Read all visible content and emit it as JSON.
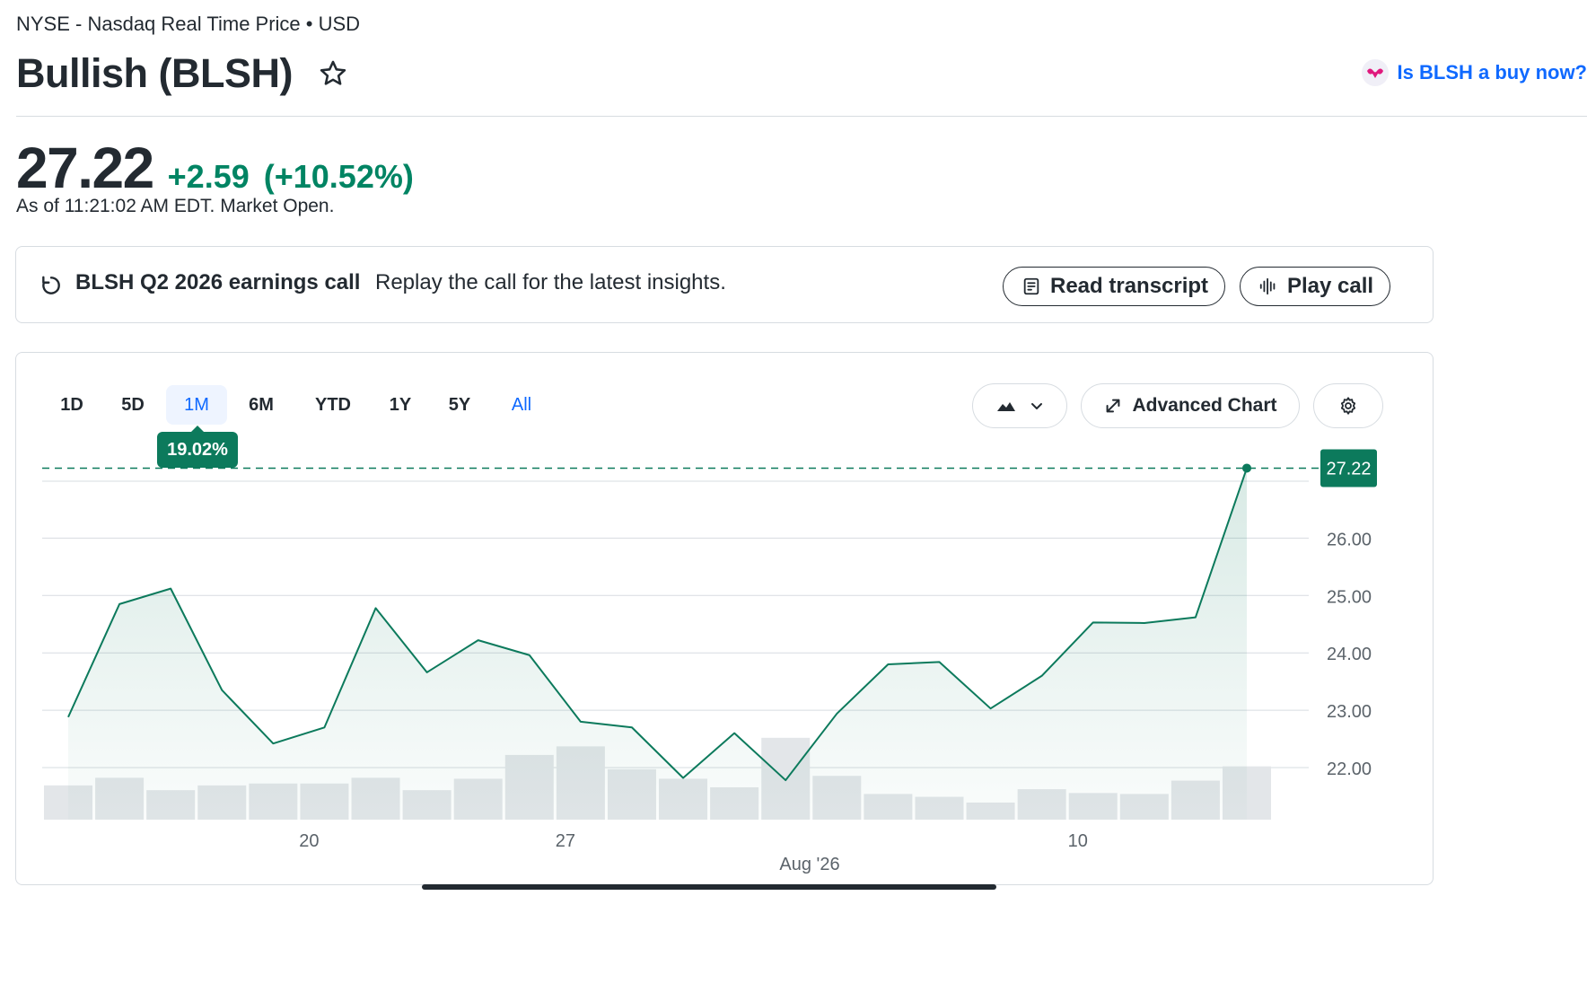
{
  "header": {
    "exchange": "NYSE - Nasdaq Real Time Price • USD",
    "title": "Bullish (BLSH)",
    "buy_link": "Is BLSH a buy now?"
  },
  "quote": {
    "price": "27.22",
    "change": "+2.59",
    "change_pct": "(+10.52%)",
    "as_of": "As of 11:21:02 AM EDT. Market Open.",
    "positive_color": "#008463"
  },
  "earnings": {
    "title": "BLSH Q2 2026 earnings call",
    "subtitle": "Replay the call for the latest insights.",
    "read_transcript": "Read transcript",
    "play_call": "Play call"
  },
  "chart_controls": {
    "ranges": [
      "1D",
      "5D",
      "1M",
      "6M",
      "YTD",
      "1Y",
      "5Y",
      "All"
    ],
    "selected_range": "1M",
    "range_return": "19.02%",
    "advanced_chart": "Advanced Chart",
    "chart_type_icon": "mountain-icon",
    "settings_icon": "gear-icon"
  },
  "chart_data": {
    "type": "area",
    "x_tick_labels": [
      "20",
      "27",
      "10"
    ],
    "x_sublabel": "Aug '26",
    "y_tick_labels": [
      "26.00",
      "25.00",
      "24.00",
      "23.00",
      "22.00"
    ],
    "ylim": [
      21.05,
      27.22
    ],
    "y_ticks": [
      22,
      23,
      24,
      25,
      26
    ],
    "current_price_label": "27.22",
    "current_price": 27.22,
    "series": [
      {
        "values": [
          22.88,
          24.85,
          25.12,
          23.35,
          22.42,
          22.7,
          24.78,
          23.66,
          24.22,
          23.96,
          22.8,
          22.7,
          21.82,
          22.6,
          21.78,
          22.94,
          23.8,
          23.84,
          23.03,
          23.6,
          24.53,
          24.52,
          24.62,
          27.22
        ],
        "color": "#0c7a5c"
      }
    ],
    "volume": [
      0.36,
      0.44,
      0.31,
      0.36,
      0.38,
      0.38,
      0.44,
      0.31,
      0.43,
      0.68,
      0.77,
      0.53,
      0.43,
      0.34,
      0.86,
      0.46,
      0.27,
      0.24,
      0.18,
      0.32,
      0.28,
      0.27,
      0.41,
      0.56
    ],
    "grid": true
  }
}
